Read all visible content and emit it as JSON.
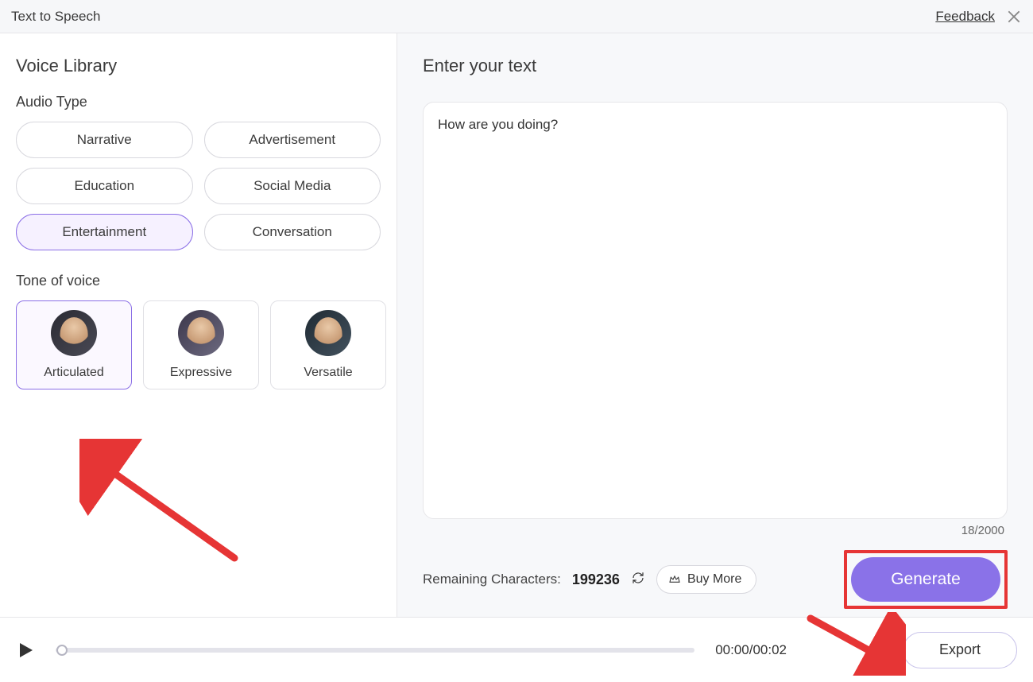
{
  "header": {
    "title": "Text to Speech",
    "feedback": "Feedback"
  },
  "left": {
    "title": "Voice Library",
    "audioTypeHead": "Audio Type",
    "audioTypes": [
      {
        "label": "Narrative",
        "selected": false
      },
      {
        "label": "Advertisement",
        "selected": false
      },
      {
        "label": "Education",
        "selected": false
      },
      {
        "label": "Social Media",
        "selected": false
      },
      {
        "label": "Entertainment",
        "selected": true
      },
      {
        "label": "Conversation",
        "selected": false
      }
    ],
    "toneHead": "Tone of voice",
    "tones": [
      {
        "label": "Articulated",
        "selected": true
      },
      {
        "label": "Expressive",
        "selected": false
      },
      {
        "label": "Versatile",
        "selected": false
      }
    ]
  },
  "right": {
    "title": "Enter your text",
    "textValue": "How are you doing?",
    "counter": "18/2000",
    "remainingLabel": "Remaining Characters:",
    "remainingValue": "199236",
    "buyMore": "Buy More",
    "generate": "Generate"
  },
  "player": {
    "time": "00:00/00:02",
    "export": "Export"
  },
  "colors": {
    "accent": "#8a72e8",
    "annotation": "#e63535"
  }
}
